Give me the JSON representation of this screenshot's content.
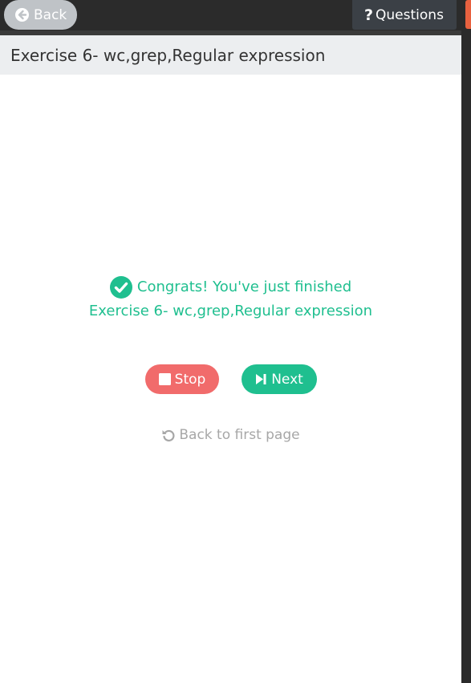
{
  "topbar": {
    "back_label": "Back",
    "questions_label": "Questions",
    "back_icon": "arrow-left-circle-icon",
    "questions_icon": "question-mark-icon"
  },
  "titlebar": {
    "title": "Exercise 6- wc,grep,Regular expression"
  },
  "main": {
    "congrats_line1": "Congrats! You've just finished",
    "congrats_line2": "Exercise 6- wc,grep,Regular expression",
    "stop_label": "Stop",
    "next_label": "Next",
    "back_to_first_label": "Back to first page"
  },
  "colors": {
    "accent_green": "#1fbf8f",
    "stop_red": "#f16b6b",
    "link_gray": "#a7a7a7"
  }
}
